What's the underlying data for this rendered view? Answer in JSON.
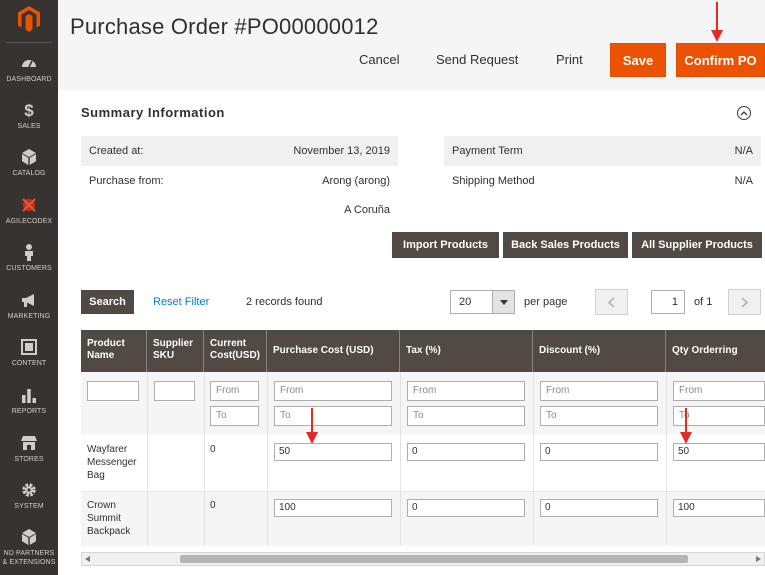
{
  "sidebar": {
    "items": [
      {
        "label": "DASHBOARD",
        "icon": "dashboard-icon"
      },
      {
        "label": "SALES",
        "icon": "dollar-icon"
      },
      {
        "label": "CATALOG",
        "icon": "cube-icon"
      },
      {
        "label": "AGILECODEX",
        "icon": "agilecodex-icon"
      },
      {
        "label": "CUSTOMERS",
        "icon": "person-icon"
      },
      {
        "label": "MARKETING",
        "icon": "megaphone-icon"
      },
      {
        "label": "CONTENT",
        "icon": "content-icon"
      },
      {
        "label": "REPORTS",
        "icon": "bar-chart-icon"
      },
      {
        "label": "STORES",
        "icon": "store-icon"
      },
      {
        "label": "SYSTEM",
        "icon": "gear-icon"
      },
      {
        "label": "ND PARTNERS",
        "label2": "& EXTENSIONS",
        "icon": "partners-icon"
      }
    ]
  },
  "page": {
    "title": "Purchase Order #PO00000012"
  },
  "actions": {
    "cancel": "Cancel",
    "send_request": "Send Request",
    "print": "Print",
    "save": "Save",
    "confirm": "Confirm PO"
  },
  "summary": {
    "title": "Summary Information",
    "created_label": "Created at:",
    "created_value": "November 13, 2019",
    "from_label": "Purchase from:",
    "from_value": "Arong (arong)",
    "from_city": "A Coruña",
    "payment_label": "Payment Term",
    "payment_value": "N/A",
    "shipping_label": "Shipping Method",
    "shipping_value": "N/A"
  },
  "product_buttons": {
    "import": "Import Products",
    "back_sales": "Back Sales Products",
    "all_supplier": "All Supplier Products"
  },
  "toolbar": {
    "search": "Search",
    "reset": "Reset Filter",
    "records": "2 records found",
    "per_page_value": "20",
    "per_page_label": "per page",
    "page": "1",
    "of": "of 1"
  },
  "grid": {
    "columns": [
      "Product Name",
      "Supplier SKU",
      "Current Cost(USD)",
      "Purchase Cost (USD)",
      "Tax (%)",
      "Discount (%)",
      "Qty Orderring"
    ],
    "filter_from": "From",
    "filter_to": "To",
    "rows": [
      {
        "name": "Wayfarer Messenger Bag",
        "sku": "",
        "current_cost": "0",
        "purchase_cost": "50",
        "tax": "0",
        "discount": "0",
        "qty": "50"
      },
      {
        "name": "Crown Summit Backpack",
        "sku": "",
        "current_cost": "0",
        "purchase_cost": "100",
        "tax": "0",
        "discount": "0",
        "qty": "100"
      }
    ]
  },
  "colors": {
    "accent": "#eb5202",
    "sidebar": "#373330",
    "header": "#514943",
    "arrow": "#e02b27"
  }
}
